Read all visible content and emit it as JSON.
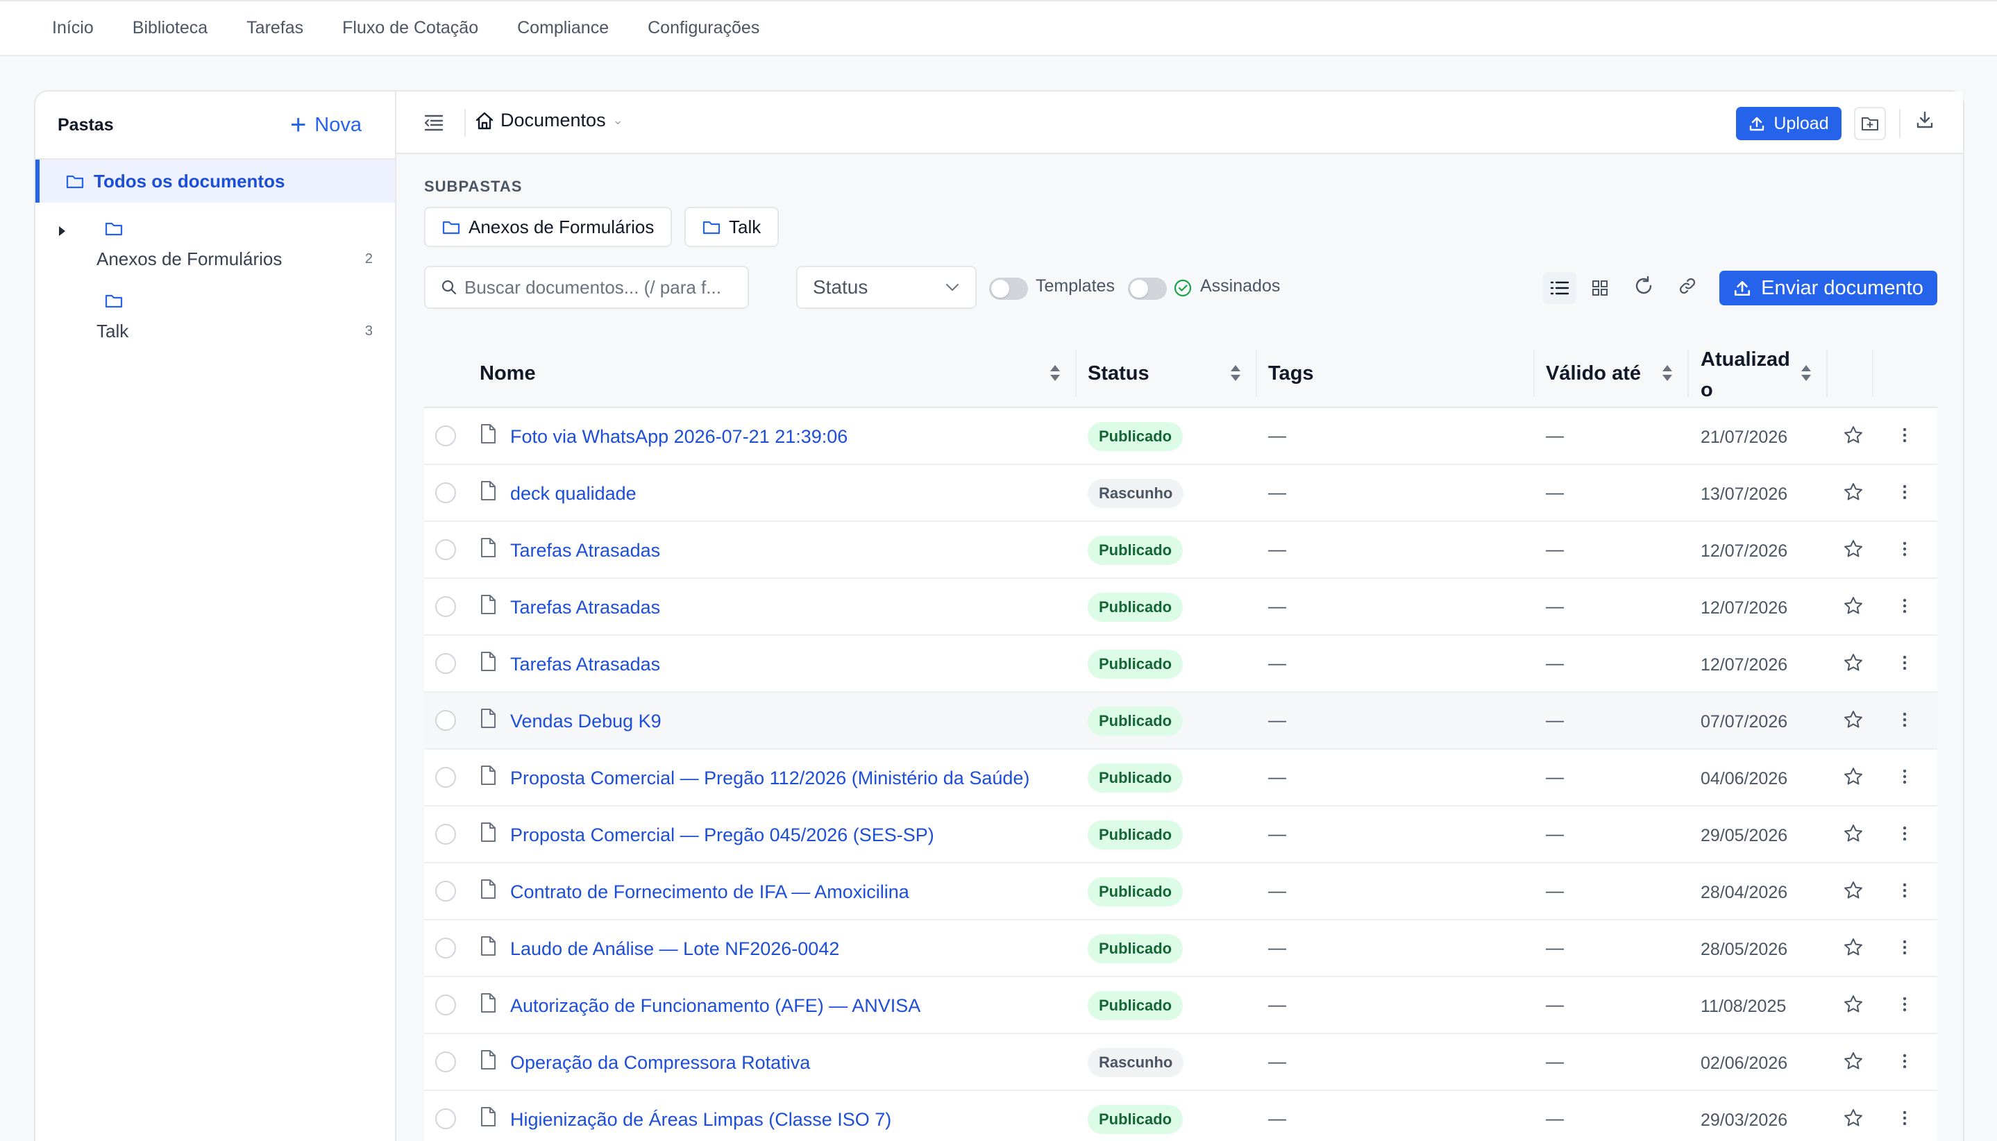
{
  "topnav": {
    "items": [
      "Início",
      "Biblioteca",
      "Tarefas",
      "Fluxo de Cotação",
      "Compliance",
      "Configurações"
    ]
  },
  "sidebar": {
    "title": "Pastas",
    "new_label": "Nova",
    "all_label": "Todos os documentos",
    "folders": [
      {
        "name": "Anexos de Formulários",
        "count": "2"
      },
      {
        "name": "Talk",
        "count": "3"
      }
    ]
  },
  "toolbar": {
    "breadcrumb": "Documentos",
    "upload_label": "Upload"
  },
  "subfolders": {
    "label": "SUBPASTAS",
    "chips": [
      "Anexos de Formulários",
      "Talk"
    ]
  },
  "filters": {
    "search_placeholder": "Buscar documentos... (/ para f...",
    "status_label": "Status",
    "templates_label": "Templates",
    "signed_label": "Assinados",
    "send_label": "Enviar documento"
  },
  "table": {
    "headers": {
      "name": "Nome",
      "status": "Status",
      "tags": "Tags",
      "valid": "Válido até",
      "updated_line1": "Atualizad",
      "updated_line2": "o"
    },
    "rows": [
      {
        "name": "Foto via WhatsApp 2026-07-21 21:39:06",
        "status": "Publicado",
        "tags": "—",
        "valid": "—",
        "updated": "21/07/2026"
      },
      {
        "name": "deck qualidade",
        "status": "Rascunho",
        "tags": "—",
        "valid": "—",
        "updated": "13/07/2026"
      },
      {
        "name": "Tarefas Atrasadas",
        "status": "Publicado",
        "tags": "—",
        "valid": "—",
        "updated": "12/07/2026"
      },
      {
        "name": "Tarefas Atrasadas",
        "status": "Publicado",
        "tags": "—",
        "valid": "—",
        "updated": "12/07/2026"
      },
      {
        "name": "Tarefas Atrasadas",
        "status": "Publicado",
        "tags": "—",
        "valid": "—",
        "updated": "12/07/2026"
      },
      {
        "name": "Vendas Debug K9",
        "status": "Publicado",
        "tags": "—",
        "valid": "—",
        "updated": "07/07/2026"
      },
      {
        "name": "Proposta Comercial — Pregão 112/2026 (Ministério da Saúde)",
        "status": "Publicado",
        "tags": "—",
        "valid": "—",
        "updated": "04/06/2026"
      },
      {
        "name": "Proposta Comercial — Pregão 045/2026 (SES-SP)",
        "status": "Publicado",
        "tags": "—",
        "valid": "—",
        "updated": "29/05/2026"
      },
      {
        "name": "Contrato de Fornecimento de IFA — Amoxicilina",
        "status": "Publicado",
        "tags": "—",
        "valid": "—",
        "updated": "28/04/2026"
      },
      {
        "name": "Laudo de Análise — Lote NF2026-0042",
        "status": "Publicado",
        "tags": "—",
        "valid": "—",
        "updated": "28/05/2026"
      },
      {
        "name": "Autorização de Funcionamento (AFE) — ANVISA",
        "status": "Publicado",
        "tags": "—",
        "valid": "—",
        "updated": "11/08/2025"
      },
      {
        "name": "Operação da Compressora Rotativa",
        "status": "Rascunho",
        "tags": "—",
        "valid": "—",
        "updated": "02/06/2026"
      },
      {
        "name": "Higienização de Áreas Limpas (Classe ISO 7)",
        "status": "Publicado",
        "tags": "—",
        "valid": "—",
        "updated": "29/03/2026"
      }
    ]
  },
  "colors": {
    "accent": "#2563eb",
    "published_bg": "#dcfce7",
    "published_fg": "#166534",
    "draft_bg": "#f1f2f4",
    "draft_fg": "#4b5563"
  }
}
